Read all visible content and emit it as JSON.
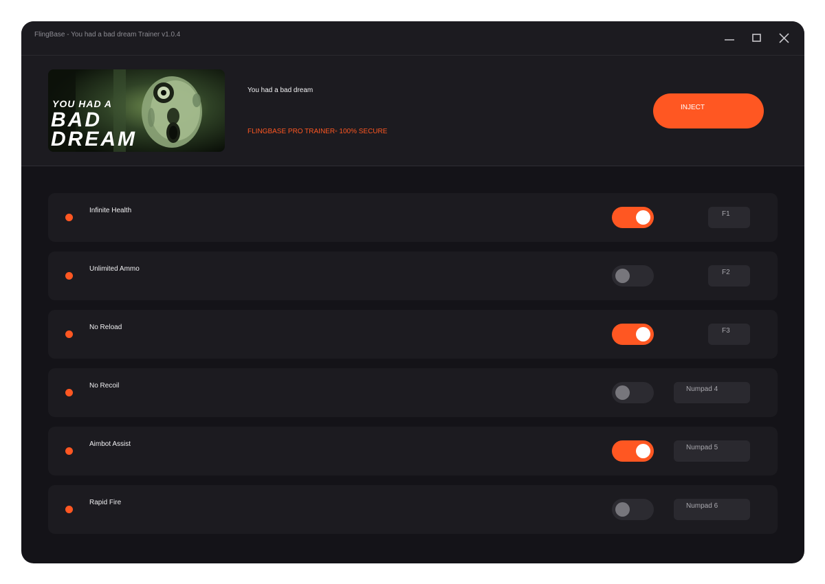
{
  "window": {
    "title": "FlingBase - You had a bad dream Trainer v1.0.4"
  },
  "header": {
    "banner_line1": "YOU HAD A",
    "banner_line2": "BAD",
    "banner_line3": "DREAM",
    "game_name": "You had a bad dream",
    "tagline": "FLINGBASE PRO TRAINER▫ 100% SECURE",
    "inject_label": "INJECT"
  },
  "colors": {
    "accent": "#ff5722",
    "background": "#141318",
    "panel": "#1c1b20"
  },
  "cheats": [
    {
      "label": "Infinite Health",
      "enabled": true,
      "hotkey": "F1"
    },
    {
      "label": "Unlimited Ammo",
      "enabled": false,
      "hotkey": "F2"
    },
    {
      "label": "No Reload",
      "enabled": true,
      "hotkey": "F3"
    },
    {
      "label": "No Recoil",
      "enabled": false,
      "hotkey": "Numpad 4"
    },
    {
      "label": "Aimbot Assist",
      "enabled": true,
      "hotkey": "Numpad 5"
    },
    {
      "label": "Rapid Fire",
      "enabled": false,
      "hotkey": "Numpad 6"
    }
  ]
}
